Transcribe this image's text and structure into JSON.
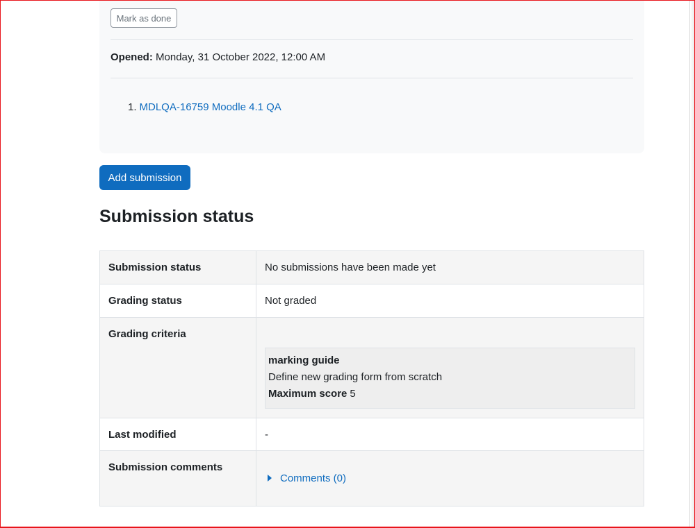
{
  "activity": {
    "mark_done_label": "Mark as done",
    "opened_label": "Opened:",
    "opened_value": "Monday, 31 October 2022, 12:00 AM",
    "list_items": [
      {
        "number": "1.",
        "text": "MDLQA-16759 Moodle 4.1 QA"
      }
    ]
  },
  "add_submission_label": "Add submission",
  "submission_heading": "Submission status",
  "status_table": {
    "rows": [
      {
        "label": "Submission status",
        "value": "No submissions have been made yet"
      },
      {
        "label": "Grading status",
        "value": "Not graded"
      },
      {
        "label": "Grading criteria",
        "value": ""
      },
      {
        "label": "Last modified",
        "value": "-"
      },
      {
        "label": "Submission comments",
        "value": ""
      }
    ],
    "grading_guide": {
      "title": "marking guide",
      "description": "Define new grading form from scratch",
      "max_score_label": "Maximum score",
      "max_score_value": "5"
    },
    "comments_link": "Comments (0)"
  },
  "colors": {
    "primary": "#0f6cbf",
    "frame": "#e8141b",
    "panel": "#f8f9fa"
  }
}
